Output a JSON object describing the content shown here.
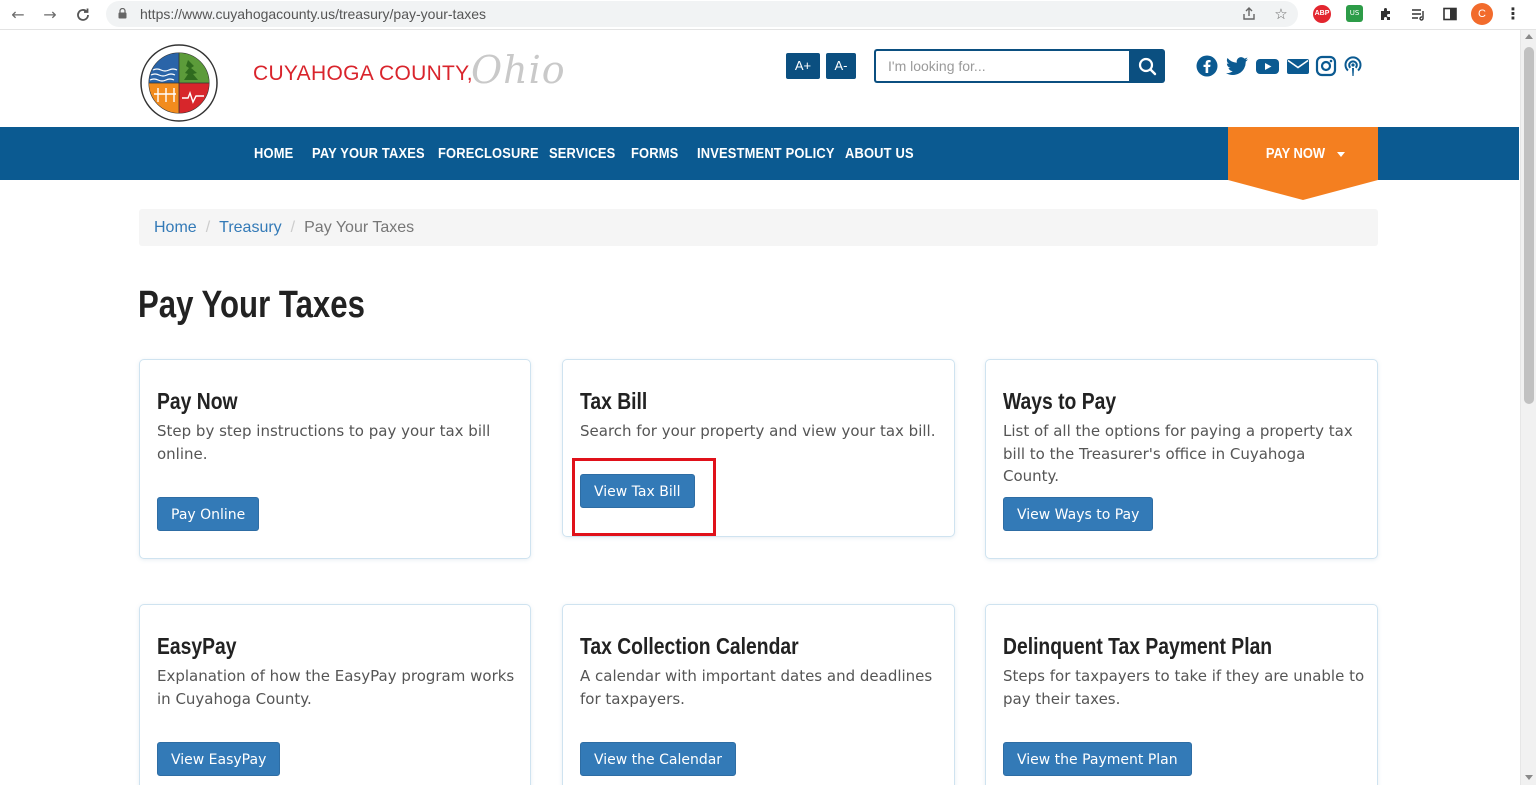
{
  "browser": {
    "url": "https://www.cuyahogacounty.us/treasury/pay-your-taxes",
    "profile_initial": "C",
    "abp_label": "ABP",
    "vpn_label": "US"
  },
  "header": {
    "county_name": "CUYAHOGA COUNTY,",
    "county_state": "Ohio",
    "font_increase": "A+",
    "font_decrease": "A-",
    "search_placeholder": "I'm looking for...",
    "social_icons": [
      "facebook-icon",
      "twitter-icon",
      "youtube-icon",
      "email-icon",
      "instagram-icon",
      "podcast-icon"
    ]
  },
  "nav": {
    "items": [
      "HOME",
      "PAY YOUR TAXES",
      "FORECLOSURE",
      "SERVICES",
      "FORMS",
      "INVESTMENT POLICY",
      "ABOUT US"
    ],
    "pay_now": "PAY NOW"
  },
  "breadcrumb": {
    "home": "Home",
    "treasury": "Treasury",
    "current": "Pay Your Taxes",
    "separator": "/"
  },
  "page": {
    "title": "Pay Your Taxes"
  },
  "cards": [
    {
      "title": "Pay Now",
      "desc": "Step by step instructions to pay your tax bill online.",
      "button": "Pay Online"
    },
    {
      "title": "Tax Bill",
      "desc": "Search for your property and view your tax bill.",
      "button": "View Tax Bill"
    },
    {
      "title": "Ways to Pay",
      "desc": "List of all the options for paying a property tax bill to the Treasurer's office in Cuyahoga County.",
      "button": "View Ways to Pay"
    },
    {
      "title": "EasyPay",
      "desc": "Explanation of how the EasyPay program works in Cuyahoga County.",
      "button": "View EasyPay"
    },
    {
      "title": "Tax Collection Calendar",
      "desc": "A calendar with important dates and deadlines for taxpayers.",
      "button": "View the Calendar"
    },
    {
      "title": "Delinquent Tax Payment Plan",
      "desc": "Steps for taxpayers to take if they are unable to pay their taxes.",
      "button": "View the Payment Plan"
    }
  ],
  "colors": {
    "nav_blue": "#0b5a91",
    "dark_blue": "#0b4f80",
    "pay_now_orange": "#f47f20",
    "button_blue": "#337ab7",
    "county_red": "#d9242c",
    "highlight_red": "#e0111a"
  }
}
